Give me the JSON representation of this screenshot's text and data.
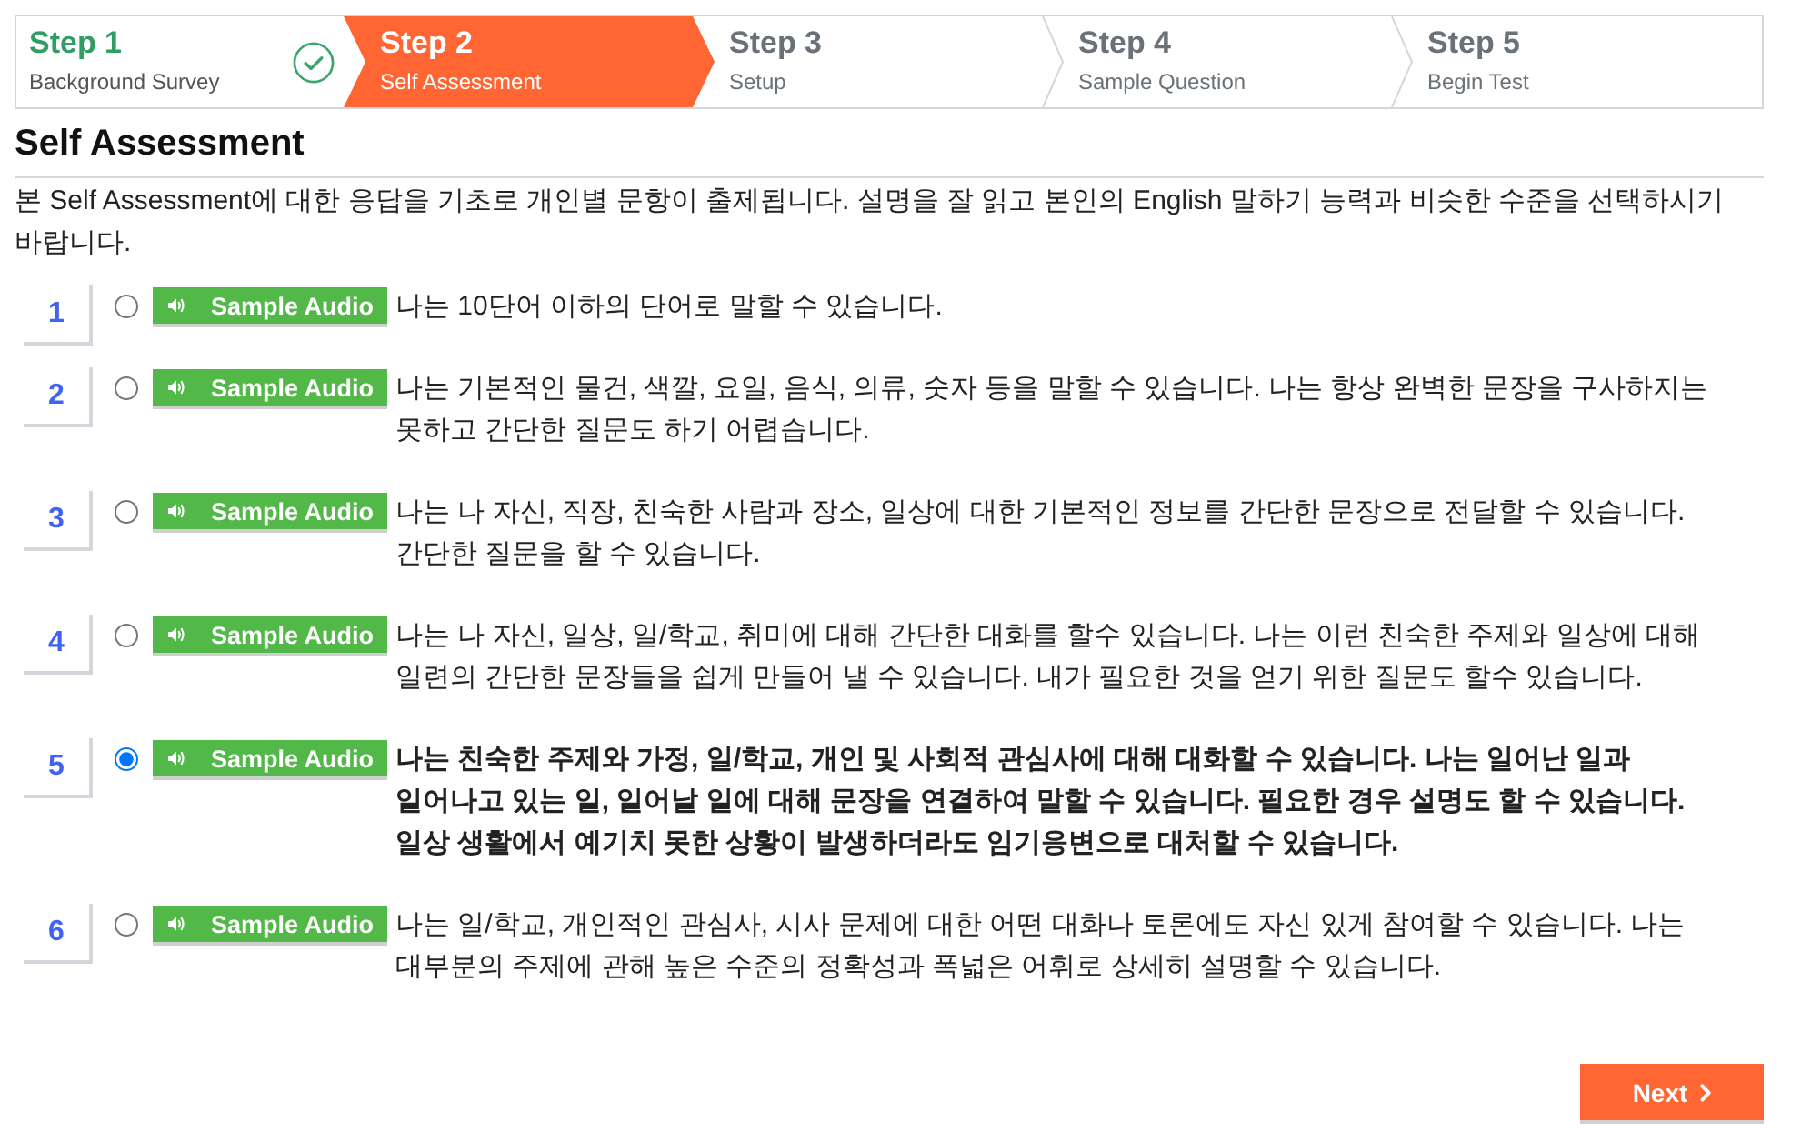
{
  "steps": [
    {
      "title": "Step 1",
      "label": "Background Survey",
      "completed": true,
      "selected": false
    },
    {
      "title": "Step 2",
      "label": "Self Assessment",
      "completed": false,
      "selected": true
    },
    {
      "title": "Step 3",
      "label": "Setup",
      "completed": false,
      "selected": false
    },
    {
      "title": "Step 4",
      "label": "Sample Question",
      "completed": false,
      "selected": false
    },
    {
      "title": "Step 5",
      "label": "Begin Test",
      "completed": false,
      "selected": false
    }
  ],
  "heading": "Self Assessment",
  "intro": "본 Self Assessment에 대한 응답을 기초로 개인별 문항이 출제됩니다. 설명을 잘 읽고 본인의 English 말하기 능력과 비슷한 수준을 선택하시기 바랍니다.",
  "options": [
    {
      "number": "1",
      "audio_label": "Sample Audio",
      "text": "나는 10단어 이하의 단어로 말할 수 있습니다.",
      "selected": false
    },
    {
      "number": "2",
      "audio_label": "Sample Audio",
      "text": "나는 기본적인 물건, 색깔, 요일, 음식, 의류, 숫자 등을 말할 수 있습니다. 나는 항상 완벽한 문장을 구사하지는 못하고 간단한 질문도 하기 어렵습니다.",
      "selected": false
    },
    {
      "number": "3",
      "audio_label": "Sample Audio",
      "text": "나는 나 자신, 직장, 친숙한 사람과 장소, 일상에 대한 기본적인 정보를 간단한 문장으로 전달할 수 있습니다. 간단한 질문을 할 수 있습니다.",
      "selected": false
    },
    {
      "number": "4",
      "audio_label": "Sample Audio",
      "text": "나는 나 자신, 일상, 일/학교, 취미에 대해 간단한 대화를 할수 있습니다. 나는 이런 친숙한 주제와 일상에 대해 일련의 간단한 문장들을 쉽게 만들어 낼 수 있습니다. 내가 필요한 것을 얻기 위한 질문도 할수 있습니다.",
      "selected": false
    },
    {
      "number": "5",
      "audio_label": "Sample Audio",
      "text": "나는 친숙한 주제와 가정, 일/학교, 개인 및 사회적 관심사에 대해 대화할 수 있습니다. 나는 일어난 일과 일어나고 있는 일, 일어날 일에 대해 문장을 연결하여 말할 수 있습니다. 필요한 경우 설명도 할 수 있습니다. 일상 생활에서 예기치 못한 상황이 발생하더라도 임기응변으로 대처할 수 있습니다.",
      "selected": true
    },
    {
      "number": "6",
      "audio_label": "Sample Audio",
      "text": "나는 일/학교, 개인적인 관심사, 시사 문제에 대한 어떤 대화나 토론에도 자신 있게 참여할 수 있습니다. 나는 대부분의 주제에 관해 높은 수준의 정확성과 폭넓은 어휘로 상세히 설명할 수 있습니다.",
      "selected": false
    }
  ],
  "next_button": "Next"
}
